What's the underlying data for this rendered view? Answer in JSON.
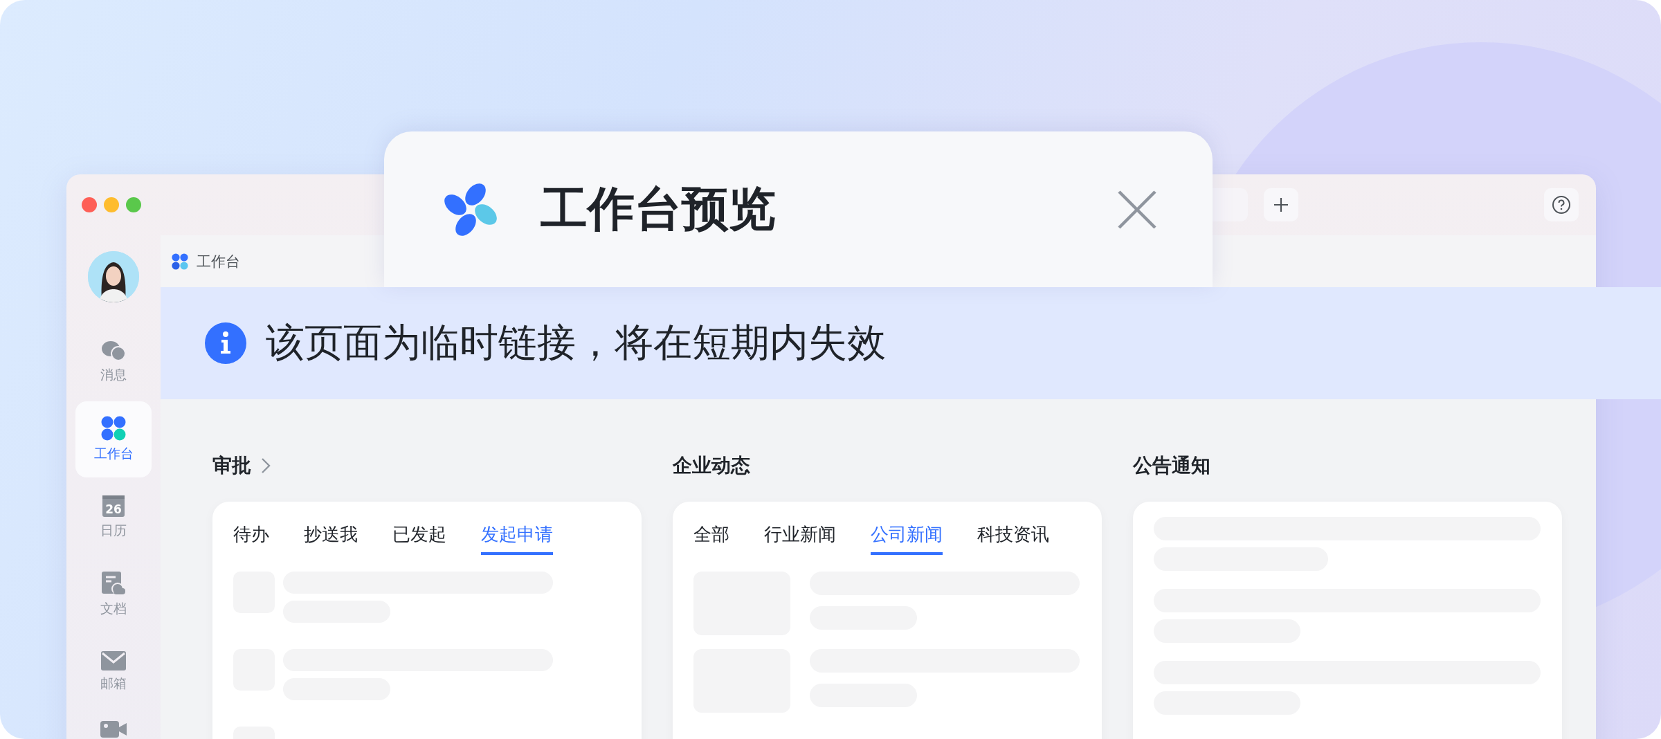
{
  "popup": {
    "title": "工作台预览"
  },
  "sidebar": {
    "items": [
      {
        "label": "消息",
        "selected": false
      },
      {
        "label": "工作台",
        "selected": true
      },
      {
        "label": "日历",
        "selected": false,
        "badge": "26"
      },
      {
        "label": "文档",
        "selected": false
      },
      {
        "label": "邮箱",
        "selected": false
      }
    ]
  },
  "header": {
    "title": "工作台"
  },
  "notice": {
    "text": "该页面为临时链接，将在短期内失效"
  },
  "sections": [
    {
      "title": "审批",
      "arrow": true,
      "kind": "list",
      "tabs": [
        {
          "label": "待办",
          "selected": false
        },
        {
          "label": "抄送我",
          "selected": false
        },
        {
          "label": "已发起",
          "selected": false
        },
        {
          "label": "发起申请",
          "selected": true
        }
      ]
    },
    {
      "title": "企业动态",
      "kind": "media",
      "tabs": [
        {
          "label": "全部",
          "selected": false
        },
        {
          "label": "行业新闻",
          "selected": false
        },
        {
          "label": "公司新闻",
          "selected": true
        },
        {
          "label": "科技资讯",
          "selected": false
        }
      ]
    },
    {
      "title": "公告通知",
      "kind": "text"
    }
  ]
}
